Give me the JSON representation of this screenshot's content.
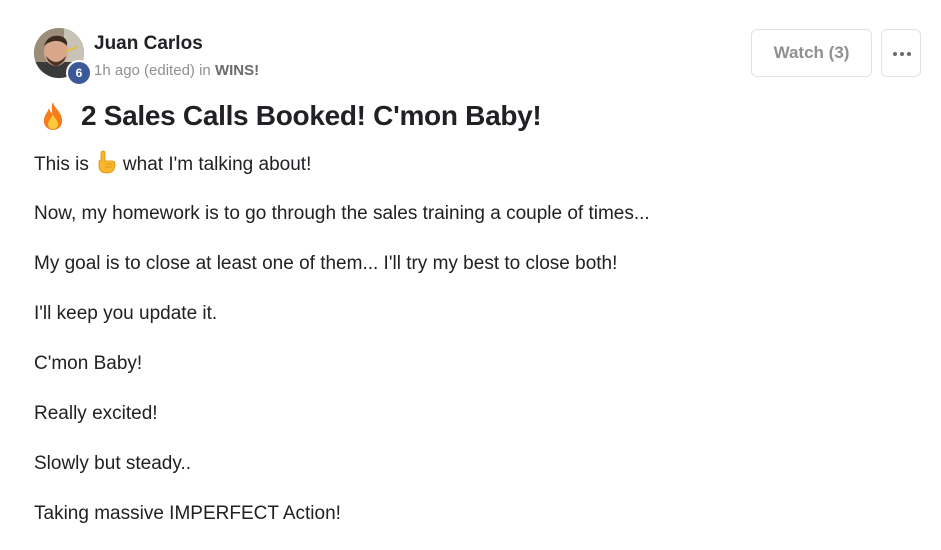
{
  "post": {
    "author": {
      "name": "Juan Carlos",
      "level": "6",
      "avatar_icon": "user-avatar-photo"
    },
    "meta": {
      "time": "1h ago (edited)",
      "in_text": "in",
      "category": "WINS!"
    },
    "actions": {
      "watch_label": "Watch (3)",
      "more_icon": "more-horizontal-icon"
    },
    "title": {
      "icon": "fire-icon",
      "text": "2 Sales Calls Booked! C'mon Baby!"
    },
    "body": {
      "first_line_before": "This is",
      "first_line_icon": "pointing-hand-icon",
      "first_line_after": "what I'm talking about!",
      "paragraphs": [
        "Now, my homework is to go through the sales training a couple of times...",
        "My goal is to close at least one of them... I'll try my best to close both!",
        "I'll keep you update it.",
        "C'mon Baby!",
        "Really excited!",
        "Slowly but steady..",
        "Taking massive IMPERFECT Action!"
      ]
    }
  },
  "colors": {
    "text": "#202124",
    "meta": "#909090",
    "badge": "#3b5998",
    "border": "#e2e2e2"
  }
}
